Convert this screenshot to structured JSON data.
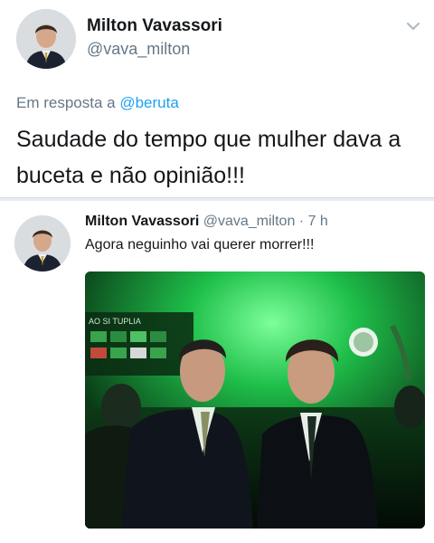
{
  "tweet1": {
    "name": "Milton Vavassori",
    "handle": "@vava_milton",
    "reply_prefix": "Em resposta a ",
    "reply_mention": "@beruta",
    "text": "Saudade do tempo que mulher dava a buceta e não opinião!!!",
    "menu_icon": "chevron-down-icon"
  },
  "tweet2": {
    "name": "Milton Vavassori",
    "handle": "@vava_milton",
    "separator": " · ",
    "time": "7 h",
    "text": "Agora neguinho vai querer morrer!!!"
  },
  "photo": {
    "background_text": "AO SI TUPLIA"
  },
  "colors": {
    "link": "#1da1f2",
    "secondary": "#657786",
    "text": "#14171a",
    "photo_green": "#2dd85a"
  }
}
